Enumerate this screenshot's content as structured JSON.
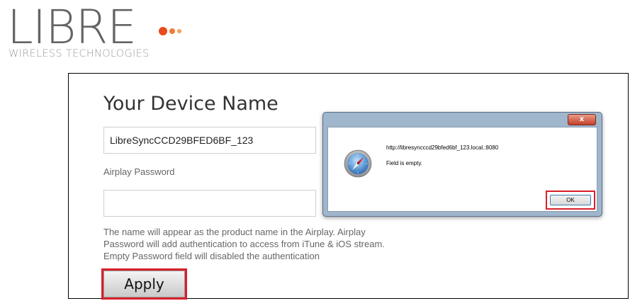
{
  "logo": {
    "wordmark": "LIBRE",
    "tagline": "WIRELESS TECHNOLOGIES",
    "dot_colors": [
      "#e8491f",
      "#ef7a3a",
      "#f6a25a"
    ]
  },
  "form": {
    "title": "Your Device Name",
    "device_name_value": "LibreSyncCCD29BFED6BF_123",
    "airplay_password_label": "Airplay Password",
    "airplay_password_value": "",
    "help_text": "The name will appear as the product name in the Airplay. Airplay Password will add authentication to access from iTune & iOS stream. Empty Password field will disabled the authentication",
    "apply_label": "Apply"
  },
  "dialog": {
    "close_label": "x",
    "icon": "safari-compass-icon",
    "url": "http://libresyncccd29bfed6bf_123.local.:8080",
    "message": "Field is empty.",
    "ok_label": "OK"
  },
  "highlight_color": "#d8202a"
}
